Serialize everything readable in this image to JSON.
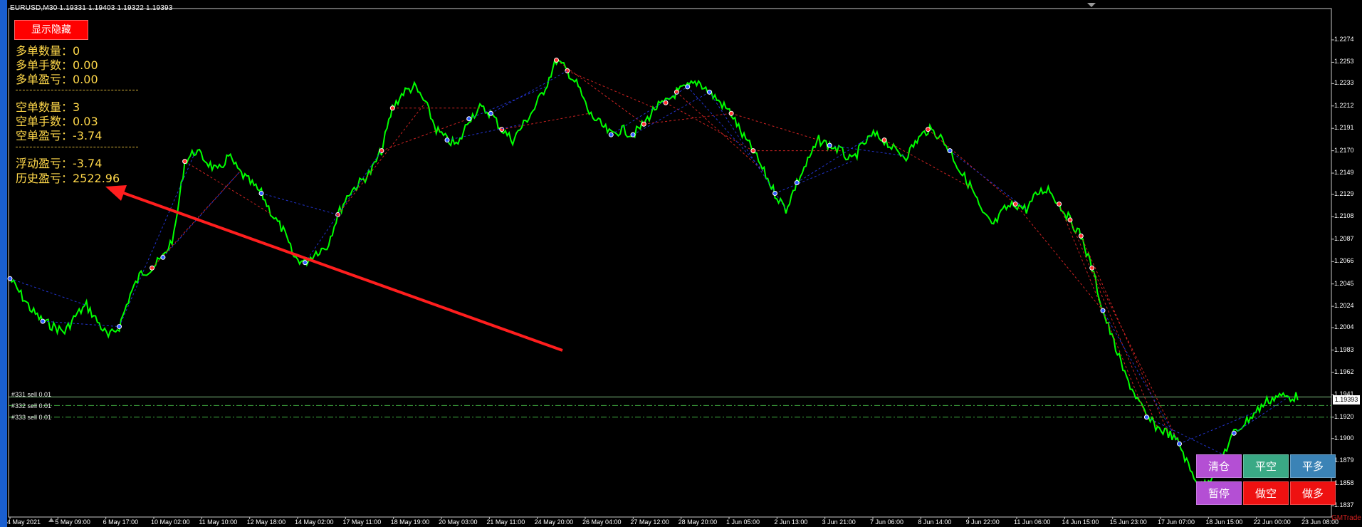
{
  "window": {
    "title": "EURUSD,M30  1.19331 1.19403 1.19322 1.19393"
  },
  "panel": {
    "toggle_label": "显示隐藏",
    "long_count": "多单数量：0",
    "long_lots": "多单手数：0.00",
    "long_pl": "多单盈亏：0.00",
    "short_count": "空单数量：3",
    "short_lots": "空单手数：0.03",
    "short_pl": "空单盈亏：-3.74",
    "floating_pl": "浮动盈亏：-3.74",
    "history_pl": "历史盈亏：2522.96"
  },
  "orders": [
    {
      "label": "#331 sell 0.01",
      "price": 1.1939
    },
    {
      "label": "#332 sell 0.01",
      "price": 1.1931
    },
    {
      "label": "#333 sell 0.01",
      "price": 1.192
    }
  ],
  "buttons": {
    "close_all": "清仓",
    "close_short": "平空",
    "close_long": "平多",
    "pause": "暂停",
    "open_short": "做空",
    "open_long": "做多"
  },
  "colors": {
    "candle": "#00ff00",
    "buy_line": "#2233cc",
    "sell_line": "#cc2222",
    "purple_btn": "#b44fd4",
    "teal_btn": "#3aa985",
    "blue_btn": "#3b83b6",
    "red_btn": "#ee1111",
    "arrow": "#ff1e1e"
  },
  "watermark": "GMTrade",
  "chart_data": {
    "type": "line",
    "symbol": "EURUSD",
    "timeframe": "M30",
    "ylim": [
      1.1837,
      1.2274
    ],
    "y_ticks": [
      "1.2274",
      "1.2253",
      "1.2233",
      "1.2212",
      "1.2191",
      "1.2170",
      "1.2149",
      "1.2129",
      "1.2108",
      "1.2087",
      "1.2066",
      "1.2045",
      "1.2024",
      "1.2004",
      "1.1983",
      "1.1962",
      "1.1941",
      "1.1920",
      "1.1900",
      "1.1879",
      "1.1858",
      "1.1837"
    ],
    "current_price": "1.19393",
    "x_ticks": [
      "4 May 2021",
      "5 May 09:00",
      "6 May 17:00",
      "10 May 02:00",
      "11 May 10:00",
      "12 May 18:00",
      "14 May 02:00",
      "17 May 11:00",
      "18 May 19:00",
      "20 May 03:00",
      "21 May 11:00",
      "24 May 20:00",
      "26 May 04:00",
      "27 May 12:00",
      "28 May 20:00",
      "1 Jun 05:00",
      "2 Jun 13:00",
      "3 Jun 21:00",
      "7 Jun 06:00",
      "8 Jun 14:00",
      "9 Jun 22:00",
      "11 Jun 06:00",
      "14 Jun 15:00",
      "15 Jun 23:00",
      "17 Jun 07:00",
      "18 Jun 15:00",
      "22 Jun 00:00",
      "23 Jun 08:00"
    ],
    "series": [
      {
        "values": [
          1.205,
          1.2035,
          1.202,
          1.201,
          1.2005,
          1.2,
          1.2015,
          1.2025,
          1.201,
          1.1995,
          1.2005,
          1.2035,
          1.2055,
          1.206,
          1.207,
          1.209,
          1.216,
          1.217,
          1.216,
          1.215,
          1.2165,
          1.215,
          1.214,
          1.213,
          1.211,
          1.2095,
          1.207,
          1.2065,
          1.2075,
          1.208,
          1.211,
          1.213,
          1.214,
          1.215,
          1.217,
          1.221,
          1.2225,
          1.223,
          1.2215,
          1.219,
          1.218,
          1.2175,
          1.22,
          1.221,
          1.2205,
          1.219,
          1.218,
          1.2195,
          1.221,
          1.223,
          1.2255,
          1.2245,
          1.223,
          1.2205,
          1.2195,
          1.2185,
          1.219,
          1.2185,
          1.2195,
          1.221,
          1.2215,
          1.2225,
          1.223,
          1.2235,
          1.2225,
          1.2215,
          1.2205,
          1.2185,
          1.217,
          1.215,
          1.213,
          1.2115,
          1.214,
          1.216,
          1.218,
          1.2175,
          1.217,
          1.216,
          1.2175,
          1.2185,
          1.218,
          1.217,
          1.2165,
          1.218,
          1.219,
          1.2185,
          1.217,
          1.215,
          1.2135,
          1.211,
          1.21,
          1.2115,
          1.212,
          1.2115,
          1.213,
          1.2135,
          1.212,
          1.2105,
          1.209,
          1.206,
          1.202,
          1.199,
          1.196,
          1.194,
          1.192,
          1.191,
          1.1905,
          1.1895,
          1.187,
          1.1855,
          1.1865,
          1.1885,
          1.1905,
          1.1915,
          1.1925,
          1.1935,
          1.194,
          1.1939
        ]
      }
    ]
  }
}
